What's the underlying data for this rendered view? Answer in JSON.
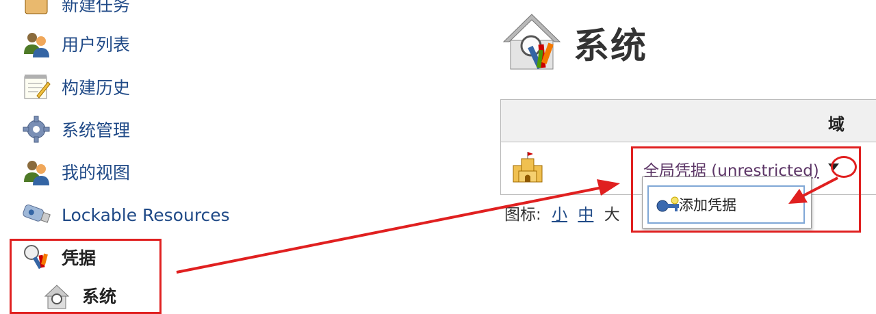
{
  "sidebar": {
    "items": [
      {
        "label": "新建任务",
        "icon": "new-task-folder-icon"
      },
      {
        "label": "用户列表",
        "icon": "users-icon"
      },
      {
        "label": "构建历史",
        "icon": "notepad-icon"
      },
      {
        "label": "系统管理",
        "icon": "gear-icon"
      },
      {
        "label": "我的视图",
        "icon": "users-icon"
      },
      {
        "label": "Lockable Resources",
        "icon": "usb-drive-icon"
      },
      {
        "label": "凭据",
        "icon": "credentials-keys-icon"
      },
      {
        "label": "系统",
        "icon": "system-house-icon"
      }
    ]
  },
  "main": {
    "title": "系统",
    "table": {
      "header_domain": "域",
      "row": {
        "credential_link": "全局凭据 (unrestricted)",
        "icon": "castle-icon"
      }
    },
    "dropdown": {
      "item_label": "添加凭据",
      "icon": "key-icon"
    },
    "icon_size": {
      "label": "图标:",
      "small": "小",
      "medium": "中",
      "large": "大"
    }
  },
  "annotation_color": "#e02020"
}
